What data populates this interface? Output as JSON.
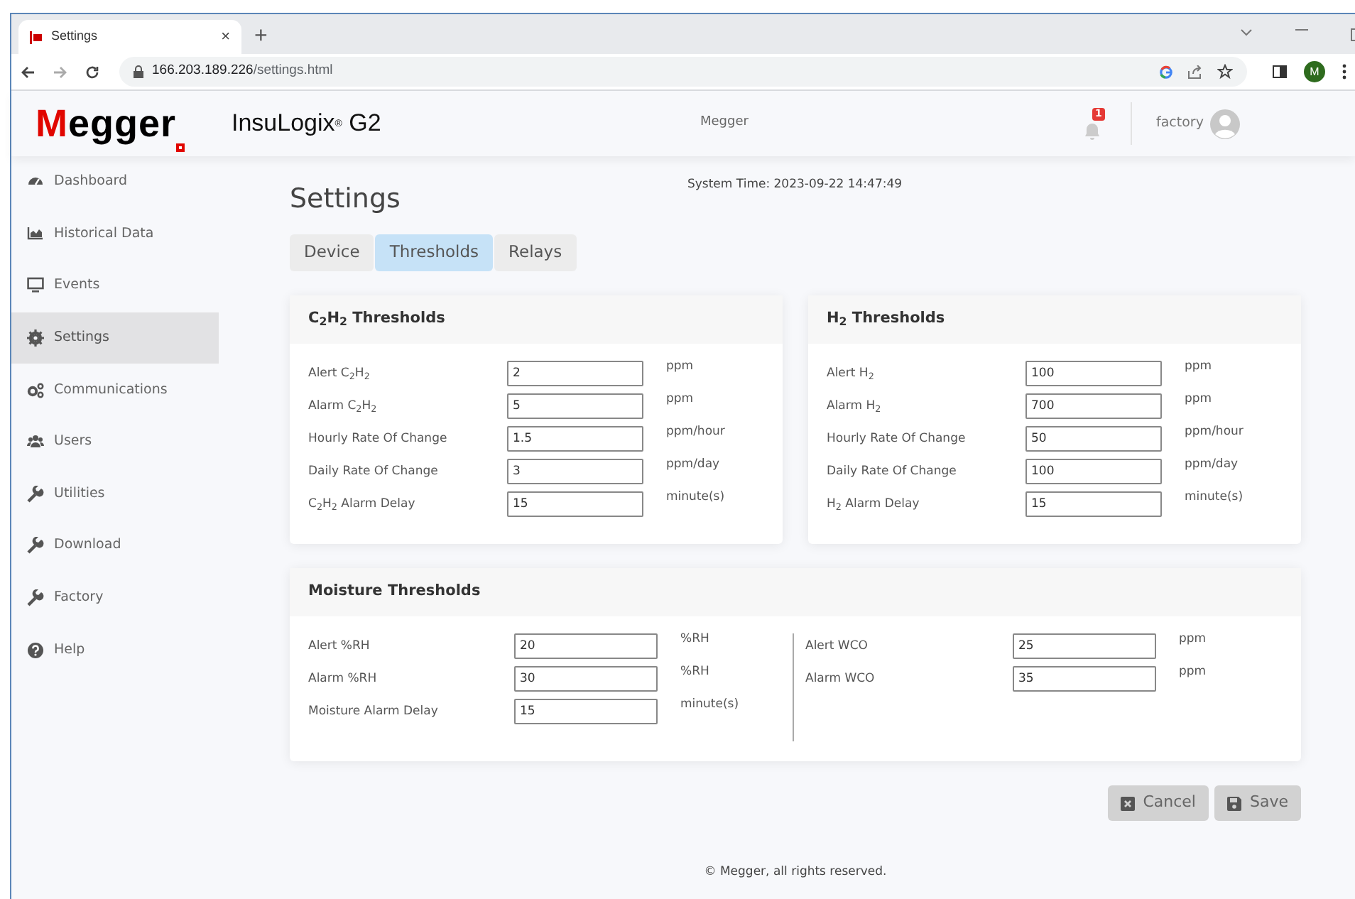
{
  "browser": {
    "tab_title": "Settings",
    "tab_close": "×",
    "new_tab": "+",
    "url_host": "166.203.189.226",
    "url_path": "/settings.html",
    "profile_initial": "M"
  },
  "header": {
    "logo": "Megger",
    "product": "InsuLogix$^{®}$ G2",
    "center": "Megger",
    "notification_count": "1",
    "user": "factory"
  },
  "sidebar": {
    "items": [
      {
        "label": "Dashboard",
        "selected": false
      },
      {
        "label": "Historical Data",
        "selected": false
      },
      {
        "label": "Events",
        "selected": false
      },
      {
        "label": "Settings",
        "selected": true
      },
      {
        "label": "Communications",
        "selected": false
      },
      {
        "label": "Users",
        "selected": false
      },
      {
        "label": "Utilities",
        "selected": false
      },
      {
        "label": "Download",
        "selected": false
      },
      {
        "label": "Factory",
        "selected": false
      },
      {
        "label": "Help",
        "selected": false
      }
    ]
  },
  "page": {
    "title": "Settings",
    "system_time": "System Time: 2023-09-22 14:47:49",
    "tabs": [
      {
        "label": "Device",
        "selected": false
      },
      {
        "label": "Thresholds",
        "selected": true
      },
      {
        "label": "Relays",
        "selected": false
      }
    ]
  },
  "cards": [
    {
      "title": "C$_{2}$H$_{2}$ Thresholds",
      "rows": [
        {
          "label": "Alert C$_{2}$H$_{2}$",
          "value": "2",
          "unit": "ppm"
        },
        {
          "label": "Alarm C$_{2}$H$_{2}$",
          "value": "5",
          "unit": "ppm"
        },
        {
          "label": "Hourly Rate Of Change",
          "value": "1.5",
          "unit": "ppm/hour"
        },
        {
          "label": "Daily Rate Of Change",
          "value": "3",
          "unit": "ppm/day"
        },
        {
          "label": "C$_{2}$H$_{2}$ Alarm Delay",
          "value": "15",
          "unit": "minute(s)"
        }
      ]
    },
    {
      "title": "H$_{2}$ Thresholds",
      "rows": [
        {
          "label": "Alert H$_{2}$",
          "value": "100",
          "unit": "ppm"
        },
        {
          "label": "Alarm H$_{2}$",
          "value": "700",
          "unit": "ppm"
        },
        {
          "label": "Hourly Rate Of Change",
          "value": "50",
          "unit": "ppm/hour"
        },
        {
          "label": "Daily Rate Of Change",
          "value": "100",
          "unit": "ppm/day"
        },
        {
          "label": "H$_{2}$ Alarm Delay",
          "value": "15",
          "unit": "minute(s)"
        }
      ]
    }
  ],
  "moisture": {
    "title": "Moisture Thresholds",
    "left": [
      {
        "label": "Alert %RH",
        "value": "20",
        "unit": "%RH"
      },
      {
        "label": "Alarm %RH",
        "value": "30",
        "unit": "%RH"
      },
      {
        "label": "Moisture Alarm Delay",
        "value": "15",
        "unit": "minute(s)"
      }
    ],
    "right": [
      {
        "label": "Alert WCO",
        "value": "25",
        "unit": "ppm"
      },
      {
        "label": "Alarm WCO",
        "value": "35",
        "unit": "ppm"
      }
    ]
  },
  "buttons": [
    {
      "label": "Cancel",
      "kind": "cancel"
    },
    {
      "label": "Save",
      "kind": "save"
    }
  ],
  "footer": "© Megger, all rights reserved."
}
